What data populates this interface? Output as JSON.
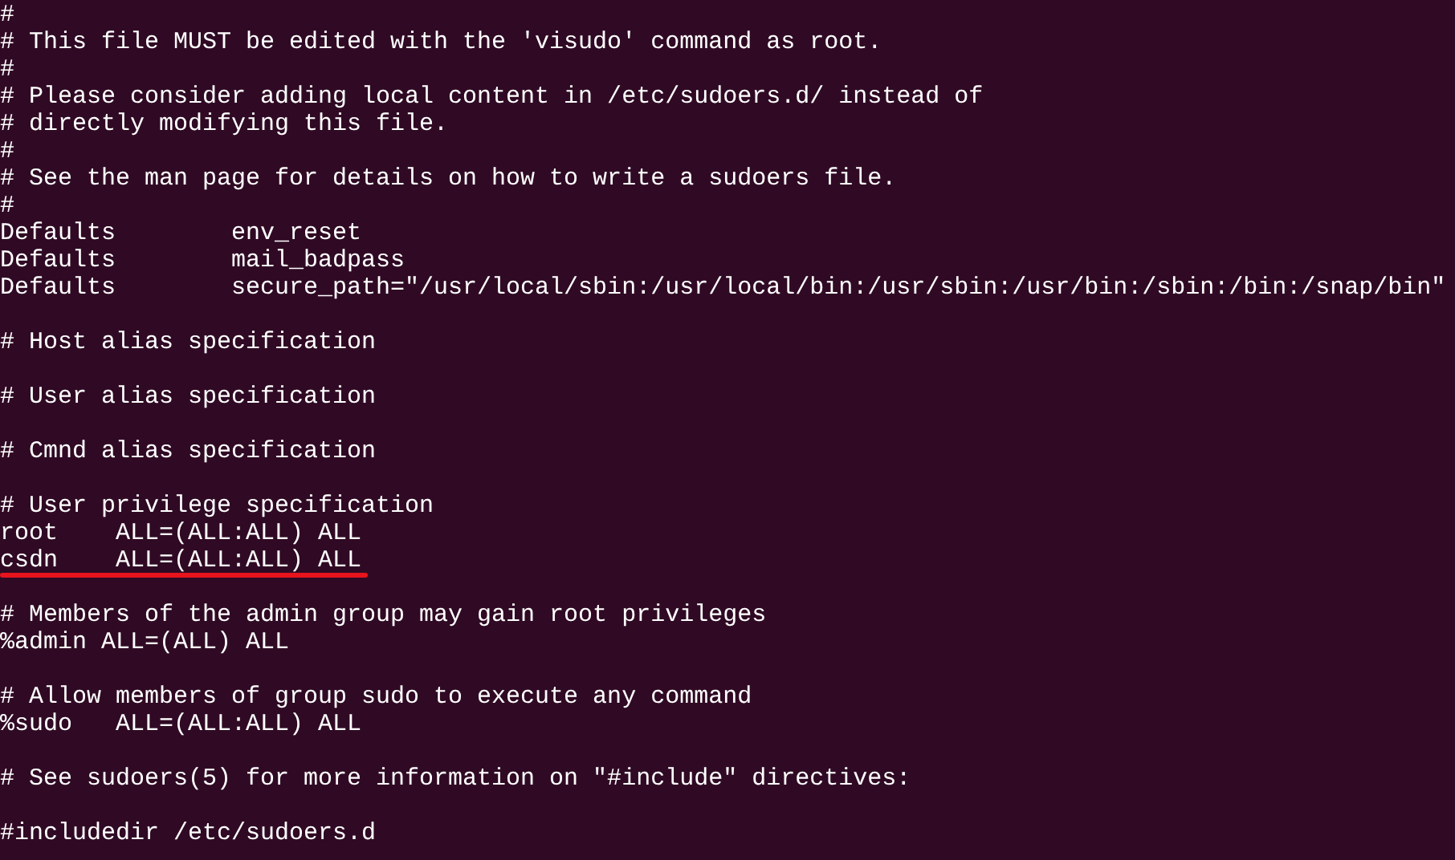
{
  "terminal": {
    "lines": [
      {
        "kind": "text",
        "text": "#",
        "underlined": false
      },
      {
        "kind": "text",
        "text": "# This file MUST be edited with the 'visudo' command as root.",
        "underlined": false
      },
      {
        "kind": "text",
        "text": "#",
        "underlined": false
      },
      {
        "kind": "text",
        "text": "# Please consider adding local content in /etc/sudoers.d/ instead of",
        "underlined": false
      },
      {
        "kind": "text",
        "text": "# directly modifying this file.",
        "underlined": false
      },
      {
        "kind": "text",
        "text": "#",
        "underlined": false
      },
      {
        "kind": "text",
        "text": "# See the man page for details on how to write a sudoers file.",
        "underlined": false
      },
      {
        "kind": "text",
        "text": "#",
        "underlined": false
      },
      {
        "kind": "text",
        "text": "Defaults        env_reset",
        "underlined": false
      },
      {
        "kind": "text",
        "text": "Defaults        mail_badpass",
        "underlined": false
      },
      {
        "kind": "text",
        "text": "Defaults        secure_path=\"/usr/local/sbin:/usr/local/bin:/usr/sbin:/usr/bin:/sbin:/bin:/snap/bin\"",
        "underlined": false
      },
      {
        "kind": "blank"
      },
      {
        "kind": "text",
        "text": "# Host alias specification",
        "underlined": false
      },
      {
        "kind": "blank"
      },
      {
        "kind": "text",
        "text": "# User alias specification",
        "underlined": false
      },
      {
        "kind": "blank"
      },
      {
        "kind": "text",
        "text": "# Cmnd alias specification",
        "underlined": false
      },
      {
        "kind": "blank"
      },
      {
        "kind": "text",
        "text": "# User privilege specification",
        "underlined": false
      },
      {
        "kind": "text",
        "text": "root    ALL=(ALL:ALL) ALL",
        "underlined": false
      },
      {
        "kind": "text",
        "text": "csdn    ALL=(ALL:ALL) ALL",
        "underlined": true
      },
      {
        "kind": "blank"
      },
      {
        "kind": "text",
        "text": "# Members of the admin group may gain root privileges",
        "underlined": false
      },
      {
        "kind": "text",
        "text": "%admin ALL=(ALL) ALL",
        "underlined": false
      },
      {
        "kind": "blank"
      },
      {
        "kind": "text",
        "text": "# Allow members of group sudo to execute any command",
        "underlined": false
      },
      {
        "kind": "text",
        "text": "%sudo   ALL=(ALL:ALL) ALL",
        "underlined": false
      },
      {
        "kind": "blank"
      },
      {
        "kind": "text",
        "text": "# See sudoers(5) for more information on \"#include\" directives:",
        "underlined": false
      },
      {
        "kind": "blank"
      },
      {
        "kind": "text",
        "text": "#includedir /etc/sudoers.d",
        "underlined": false
      }
    ]
  }
}
